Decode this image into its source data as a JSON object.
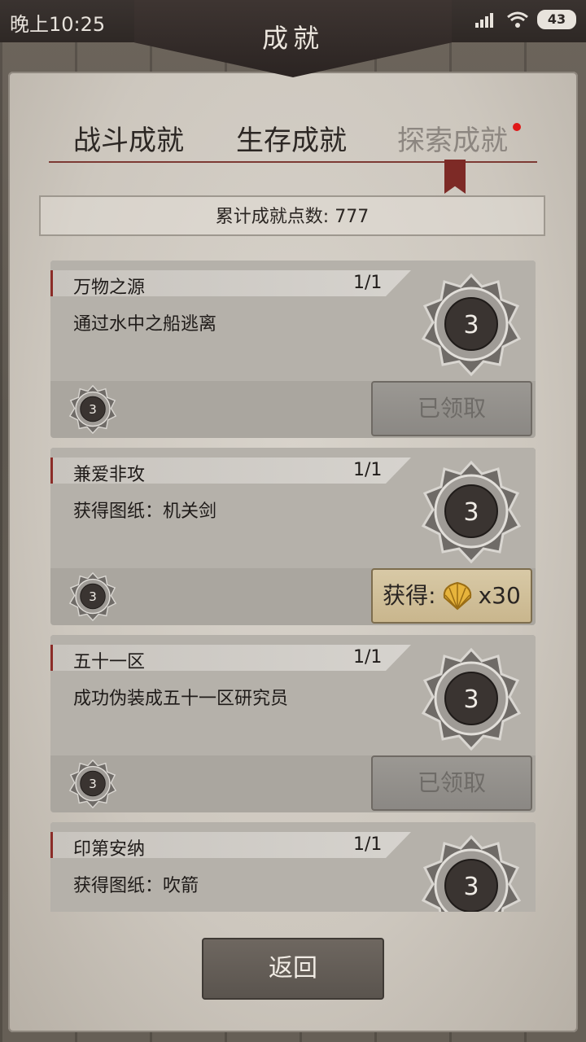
{
  "status_bar": {
    "time": "晚上10:25",
    "battery": "43"
  },
  "header": {
    "title": "成就"
  },
  "tabs": [
    {
      "label": "战斗成就"
    },
    {
      "label": "生存成就"
    },
    {
      "label": "探索成就",
      "selected": true
    }
  ],
  "summary": {
    "points_label": "累计成就点数: 777"
  },
  "achievements": [
    {
      "name": "万物之源",
      "progress": "1/1",
      "description": "通过水中之船逃离",
      "points": "3",
      "button": "已领取"
    },
    {
      "name": "兼爱非攻",
      "progress": "1/1",
      "description": "获得图纸：机关剑",
      "points": "3",
      "reward_label": "获得:",
      "reward_icon": "shell-icon",
      "reward_qty": "x30"
    },
    {
      "name": "五十一区",
      "progress": "1/1",
      "description": "成功伪装成五十一区研究员",
      "points": "3",
      "button": "已领取"
    },
    {
      "name": "印第安纳",
      "progress": "1/1",
      "description": "获得图纸：吹箭",
      "points": "3"
    }
  ],
  "footer": {
    "back_label": "返回"
  },
  "colors": {
    "accent": "#7d2a26",
    "notification_dot": "#e01818",
    "reward_bg": "#d8c9a6"
  }
}
